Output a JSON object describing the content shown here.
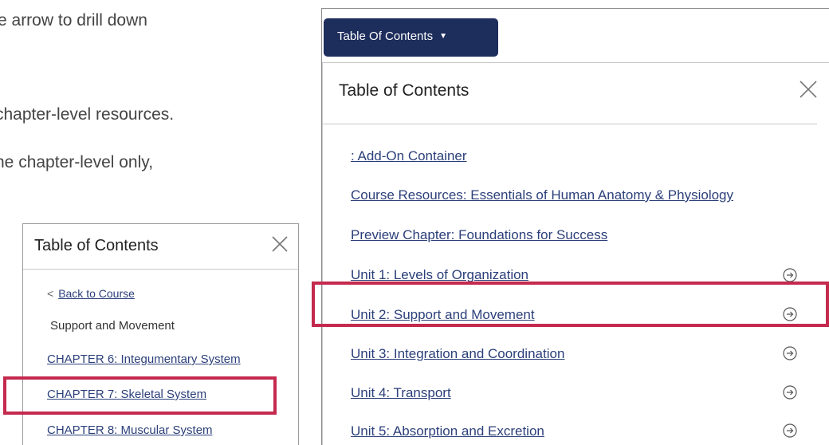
{
  "intro": {
    "line1": "e arrow to drill down",
    "line2": "chapter-level resources.",
    "line3": "ne chapter-level only,"
  },
  "small_panel": {
    "title": "Table of Contents",
    "back_label": "Back to Course",
    "unit_label": "Support and Movement",
    "chapters": [
      "CHAPTER 6: Integumentary System",
      "CHAPTER 7: Skeletal System",
      "CHAPTER 8: Muscular System"
    ]
  },
  "big_panel": {
    "button_label": "Table Of Contents",
    "title": "Table of Contents",
    "items": [
      ": Add-On Container",
      "Course Resources: Essentials of Human Anatomy & Physiology",
      "Preview Chapter: Foundations for Success",
      "Unit 1: Levels of Organization",
      "Unit 2: Support and Movement",
      "Unit 3: Integration and Coordination",
      "Unit 4: Transport",
      "Unit 5: Absorption and Excretion"
    ]
  },
  "icons": {
    "close": "close-icon",
    "chevron_left": "chevron-left-icon",
    "caret_down": "caret-down-icon",
    "drill": "circle-arrow-right-icon"
  },
  "colors": {
    "link": "#2b3f7a",
    "button_bg": "#1d2d5c",
    "highlight": "#c42a4e"
  }
}
